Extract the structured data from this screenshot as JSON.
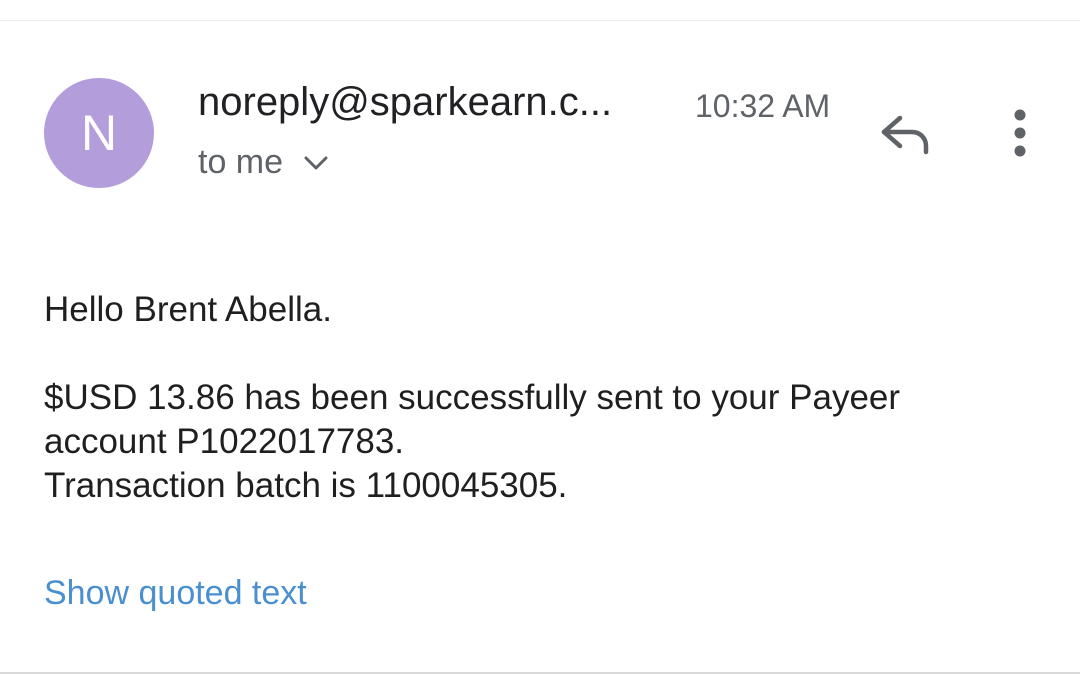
{
  "header": {
    "avatar_letter": "N",
    "sender": "noreply@sparkearn.c...",
    "time": "10:32 AM",
    "recipient_label": "to me",
    "recipient_toggle_icon": "chevron-down-icon",
    "reply_icon": "reply-icon",
    "more_icon": "more-vert-icon"
  },
  "message": {
    "greeting": "Hello Brent Abella.",
    "lines": [
      "$USD 13.86 has been successfully sent to your Payeer",
      "account P1022017783.",
      "Transaction batch is 1100045305."
    ]
  },
  "footer": {
    "show_quoted_label": "Show quoted text"
  },
  "colors": {
    "avatar_bg": "#b39ddb",
    "link": "#4a8fcf",
    "secondary_text": "#5f6368"
  }
}
